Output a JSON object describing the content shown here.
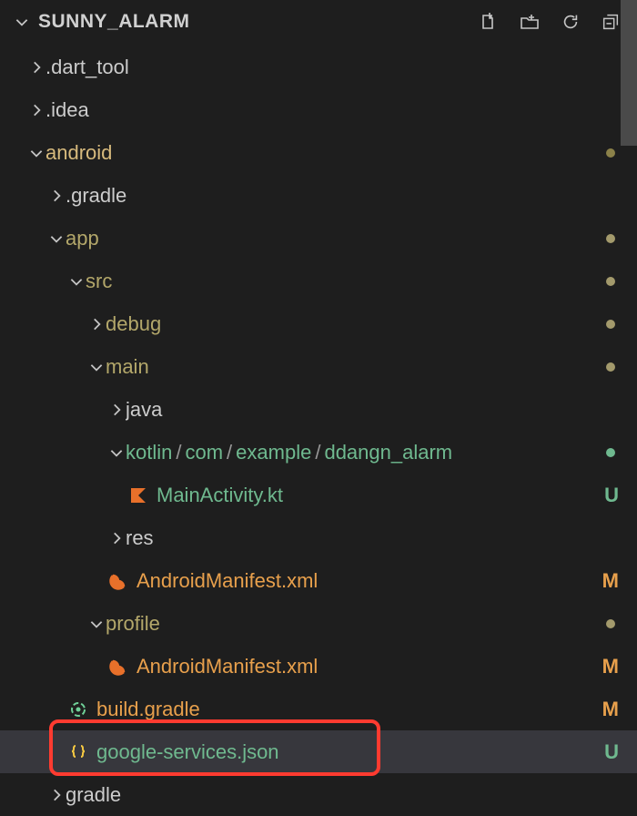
{
  "header": {
    "title": "SUNNY_ALARM"
  },
  "tree": {
    "dart_tool": ".dart_tool",
    "idea": ".idea",
    "android": "android",
    "gradle_hidden": ".gradle",
    "app": "app",
    "src": "src",
    "debug": "debug",
    "main": "main",
    "java": "java",
    "kotlin_path_1": "kotlin",
    "kotlin_path_2": "com",
    "kotlin_path_3": "example",
    "kotlin_path_4": "ddangn_alarm",
    "main_activity": "MainActivity.kt",
    "res": "res",
    "manifest": "AndroidManifest.xml",
    "profile": "profile",
    "manifest_profile": "AndroidManifest.xml",
    "build_gradle": "build.gradle",
    "google_services": "google-services.json",
    "gradle": "gradle"
  },
  "status": {
    "U": "U",
    "M": "M"
  }
}
